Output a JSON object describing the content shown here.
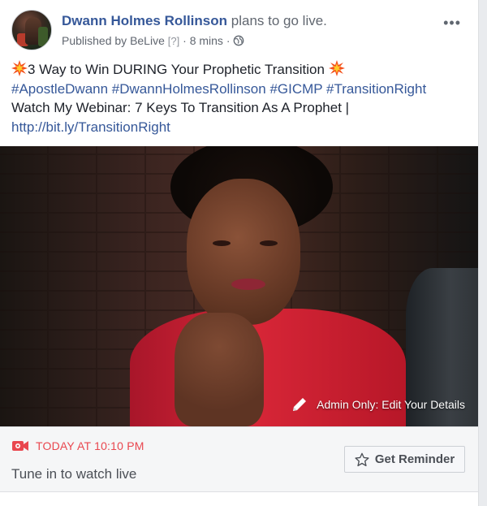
{
  "post": {
    "author": "Dwann Holmes Rollinson",
    "action": "plans to go live.",
    "published_by_prefix": "Published by",
    "app_name": "BeLive",
    "help_marker": "[?]",
    "separator": "·",
    "time": "8 mins",
    "more_label": "•••"
  },
  "content": {
    "title": "3 Way to Win DURING Your Prophetic Transition",
    "hashtags": "#ApostleDwann #DwannHolmesRollinson #GICMP #TransitionRight",
    "webinar": "Watch My Webinar: 7 Keys To Transition As A Prophet |",
    "link": "http://bit.ly/TransitionRight"
  },
  "media": {
    "edit_label": "Admin Only: Edit Your Details"
  },
  "live": {
    "schedule": "TODAY AT 10:10 PM",
    "subtitle": "Tune in to watch live",
    "reminder_label": "Get Reminder"
  },
  "colors": {
    "link_blue": "#365899",
    "live_red": "#e9474f",
    "jacket_red": "#d72637"
  },
  "icons": [
    "globe-icon",
    "burst-icon",
    "pencil-icon",
    "video-camera-icon",
    "star-icon",
    "more-icon"
  ]
}
